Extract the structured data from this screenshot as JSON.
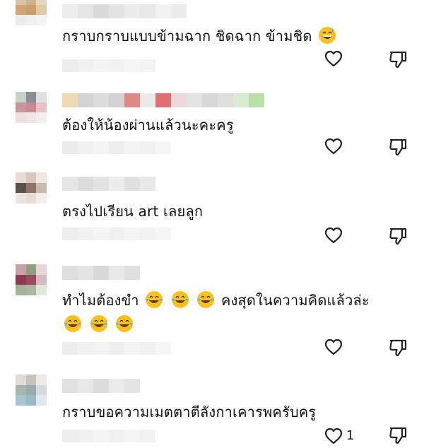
{
  "comments": [
    {
      "text": "กราบกราบแบบข้ามฉาก ชิดฉาก ข้ามชิด",
      "emoji_after": "sweat-smile-emoji",
      "likes": ""
    },
    {
      "text": "ต้องให้น้องผ่านแล้วนะคะครู",
      "likes": ""
    },
    {
      "text": "ตรงไปเรียน art เลยลูก",
      "likes": ""
    },
    {
      "text_a": "ทำไมต้องขำ",
      "text_b": "คงสุดในความคิดแล้วล่ะ",
      "emoji_mid": "tears-of-joy-emoji",
      "likes": ""
    },
    {
      "text": "กราบขอความเมตตาตีลังกาเคารพครับครู",
      "likes": "1"
    }
  ],
  "icons": {
    "like": "heart-outline-icon",
    "dislike": "thumbs-down-outline-icon"
  },
  "colors": {
    "text": "#111111",
    "icon": "#222222",
    "blur_light": "#e9e9e9",
    "blur_mid": "#d4d4d4"
  }
}
